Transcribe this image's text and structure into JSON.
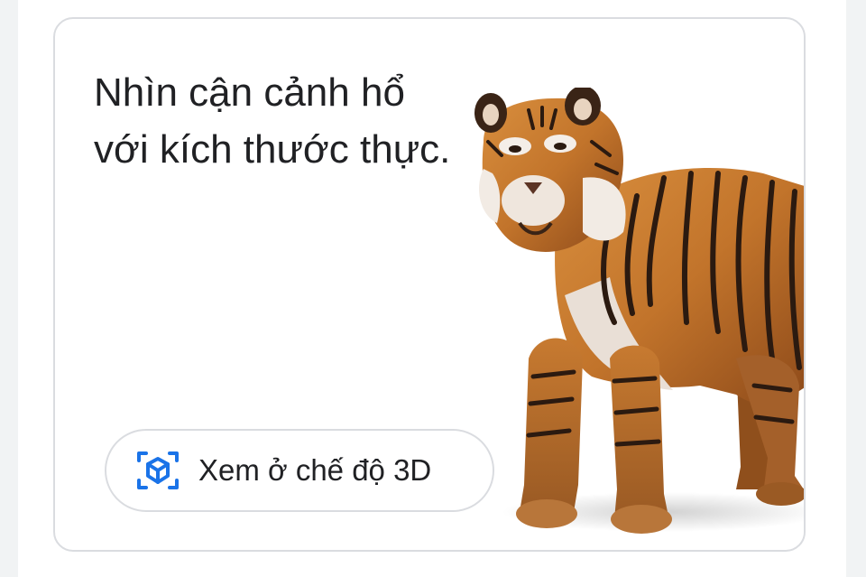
{
  "card": {
    "headline": "Nhìn cận cảnh hổ với kích thước thực.",
    "image_subject": "tiger",
    "view_3d_button": {
      "label": "Xem ở chế độ 3D",
      "icon": "ar-cube-icon"
    }
  },
  "colors": {
    "accent": "#1a73e8",
    "text": "#202124",
    "border": "#dadce0",
    "gutter": "#f1f3f4"
  }
}
